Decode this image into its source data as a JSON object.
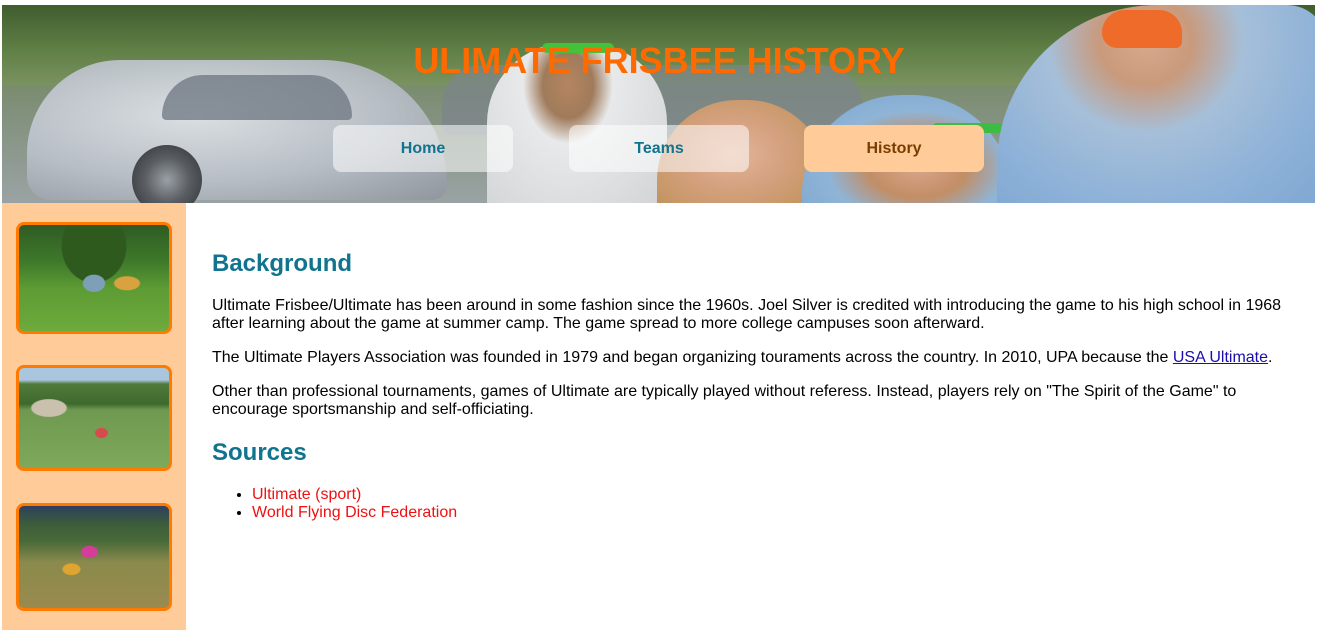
{
  "header": {
    "title": "ULIMATE FRISBEE HISTORY",
    "nav": [
      {
        "label": "Home"
      },
      {
        "label": "Teams"
      },
      {
        "label": "History",
        "active": true
      }
    ]
  },
  "sidebar": {
    "images": [
      {
        "icon": "frisbee-game-photo-1"
      },
      {
        "icon": "frisbee-game-photo-2"
      },
      {
        "icon": "frisbee-game-photo-3"
      }
    ]
  },
  "main": {
    "background_heading": "Background",
    "p1": "Ultimate Frisbee/Ultimate has been around in some fashion since the 1960s. Joel Silver is credited with introducing the game to his high school in 1968 after learning about the game at summer camp. The game spread to more college campuses soon afterward.",
    "p2_before": "The Ultimate Players Association was founded in 1979 and began organizing touraments across the country. In 2010, UPA because the ",
    "p2_link": "USA Ultimate",
    "p2_after": ".",
    "p3": "Other than professional tournaments, games of Ultimate are typically played without referess. Instead, players rely on \"The Spirit of the Game\" to encourage sportsmanship and self-officiating.",
    "sources_heading": "Sources",
    "sources": [
      "Ultimate (sport)",
      "World Flying Disc Federation"
    ]
  },
  "colors": {
    "title": "#ff6a00",
    "heading": "#10748e",
    "sidebar_bg": "#ffcc99",
    "thumb_border": "#ff7a00",
    "source_link": "#ee1111"
  }
}
